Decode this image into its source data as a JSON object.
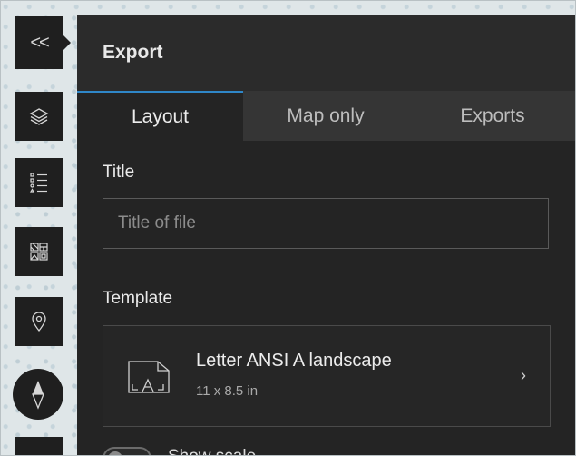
{
  "toolbar": {
    "collapse_label": "<<",
    "tools": [
      {
        "icon": "layers-icon"
      },
      {
        "icon": "legend-icon"
      },
      {
        "icon": "basemap-gallery-icon"
      },
      {
        "icon": "location-icon"
      },
      {
        "icon": "compass-icon"
      }
    ]
  },
  "panel": {
    "title": "Export",
    "tabs": [
      {
        "label": "Layout",
        "active": true
      },
      {
        "label": "Map only",
        "active": false
      },
      {
        "label": "Exports",
        "active": false
      }
    ],
    "title_field": {
      "label": "Title",
      "placeholder": "Title of file",
      "value": ""
    },
    "template": {
      "label": "Template",
      "name": "Letter ANSI A landscape",
      "size": "11 x 8.5 in",
      "chevron": "›"
    },
    "toggle": {
      "label": "Show scale",
      "on": false
    }
  },
  "colors": {
    "panel_bg": "#242424",
    "header_bg": "#2b2b2b",
    "tab_bar_bg": "#353535",
    "accent": "#2f87c8",
    "toolbar_bg": "#1f1f1f"
  }
}
